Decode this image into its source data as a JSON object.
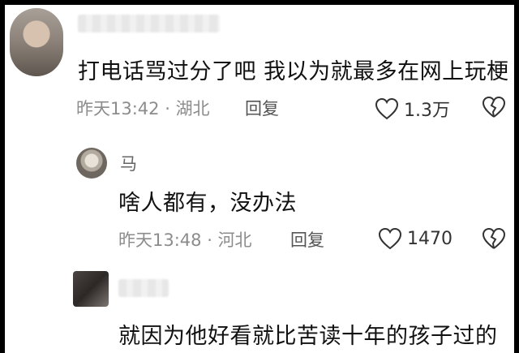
{
  "comments": [
    {
      "username": "",
      "text": "打电话骂过分了吧 我以为就最多在网上玩梗",
      "time": "昨天13:42",
      "location": "湖北",
      "reply_label": "回复",
      "like_count": "1.3万"
    },
    {
      "username": "马",
      "text": "啥人都有，没办法",
      "time": "昨天13:48",
      "location": "河北",
      "reply_label": "回复",
      "like_count": "1470"
    },
    {
      "username": "",
      "text": "就因为他好看就比苦读十年的孩子过的"
    }
  ],
  "separator": " · ",
  "icons": {
    "like": "heart-outline-icon",
    "dislike": "broken-heart-icon"
  },
  "colors": {
    "background": "#ffffff",
    "frame": "#000000",
    "meta": "#8c8c8c",
    "text": "#111111"
  }
}
